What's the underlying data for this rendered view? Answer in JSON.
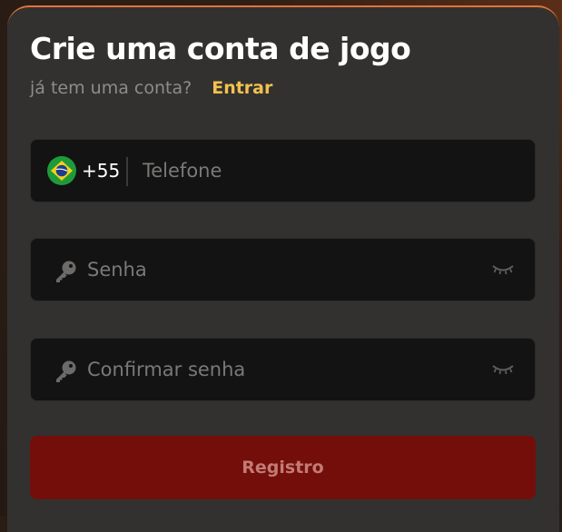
{
  "form": {
    "title": "Crie uma conta de jogo",
    "subtitle_question": "já tem uma conta?",
    "login_link": "Entrar",
    "phone": {
      "flag_icon": "brazil-flag-icon",
      "dial_code": "+55",
      "placeholder": "Telefone",
      "value": ""
    },
    "password": {
      "icon": "key-icon",
      "placeholder": "Senha",
      "value": "",
      "toggle_icon": "eye-closed-icon"
    },
    "confirm_password": {
      "icon": "key-icon",
      "placeholder": "Confirmar senha",
      "value": "",
      "toggle_icon": "eye-closed-icon"
    },
    "submit_label": "Registro"
  },
  "colors": {
    "accent_border": "#e2733a",
    "link": "#f2c14e",
    "submit_bg": "#740e0b",
    "submit_text": "#c27b74",
    "panel_bg": "#323130",
    "field_bg": "#131313"
  }
}
